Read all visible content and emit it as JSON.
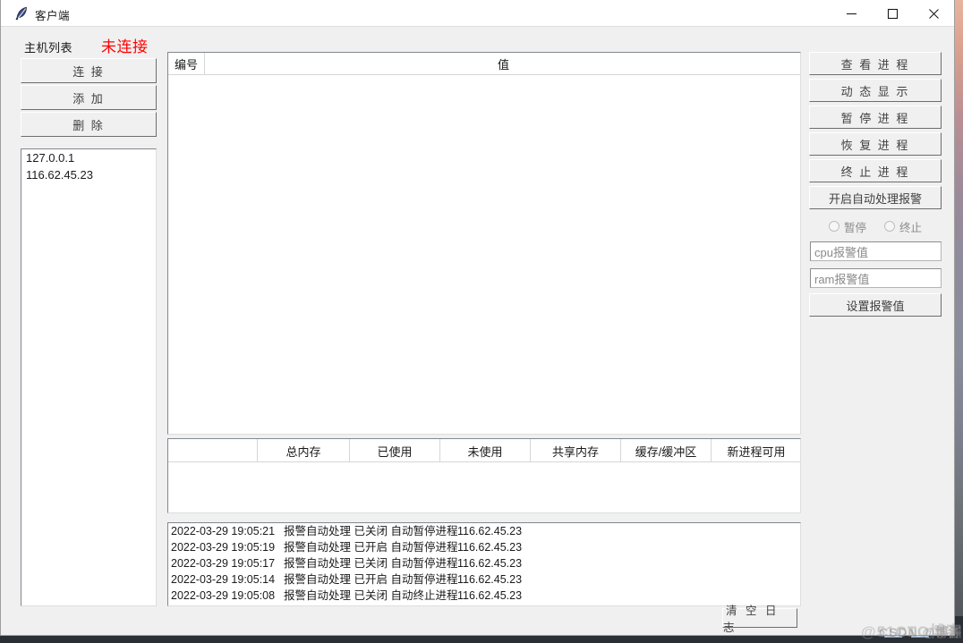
{
  "window": {
    "title": "客户端",
    "icon": "feather-icon",
    "controls": {
      "minimize": "minimize-icon",
      "maximize": "maximize-icon",
      "close": "close-icon"
    }
  },
  "left_panel": {
    "host_list_label": "主机列表",
    "connection_status": "未连接",
    "connection_status_color": "#ff0000",
    "buttons": {
      "connect": "连  接",
      "add": "添  加",
      "delete": "删  除"
    },
    "hosts": [
      "127.0.0.1",
      "116.62.45.23"
    ]
  },
  "process_table": {
    "columns": [
      "编号",
      "值"
    ],
    "rows": []
  },
  "memory_table": {
    "columns": [
      "",
      "总内存",
      "已使用",
      "未使用",
      "共享内存",
      "缓存/缓冲区",
      "新进程可用"
    ],
    "rows": []
  },
  "log_panel": {
    "rows": [
      {
        "time": "2022-03-29 19:05:21",
        "message": "报警自动处理 已关闭 自动暂停进程",
        "ip": "116.62.45.23"
      },
      {
        "time": "2022-03-29 19:05:19",
        "message": "报警自动处理 已开启 自动暂停进程",
        "ip": "116.62.45.23"
      },
      {
        "time": "2022-03-29 19:05:17",
        "message": "报警自动处理 已关闭 自动暂停进程",
        "ip": "116.62.45.23"
      },
      {
        "time": "2022-03-29 19:05:14",
        "message": "报警自动处理 已开启 自动暂停进程",
        "ip": "116.62.45.23"
      },
      {
        "time": "2022-03-29 19:05:08",
        "message": "报警自动处理 已关闭 自动终止进程",
        "ip": "116.62.45.23"
      }
    ],
    "clear_log_button": "清 空 日 志"
  },
  "right_panel": {
    "buttons": {
      "view_process": "查 看 进 程",
      "dynamic_display": "动 态 显 示",
      "pause_process": "暂 停 进 程",
      "resume_process": "恢 复 进 程",
      "stop_process": "终 止 进 程",
      "enable_auto_alarm": "开启自动处理报警",
      "set_alarm_value": "设置报警值"
    },
    "radios": [
      {
        "label": "暂停",
        "selected": false
      },
      {
        "label": "终止",
        "selected": false
      }
    ],
    "inputs": {
      "cpu_alarm": {
        "value": "",
        "placeholder": "cpu报警值"
      },
      "ram_alarm": {
        "value": "",
        "placeholder": "ram报警值"
      }
    }
  },
  "watermarks": {
    "primary": "@51CTO博客",
    "secondary": "CSDN @博渊"
  }
}
